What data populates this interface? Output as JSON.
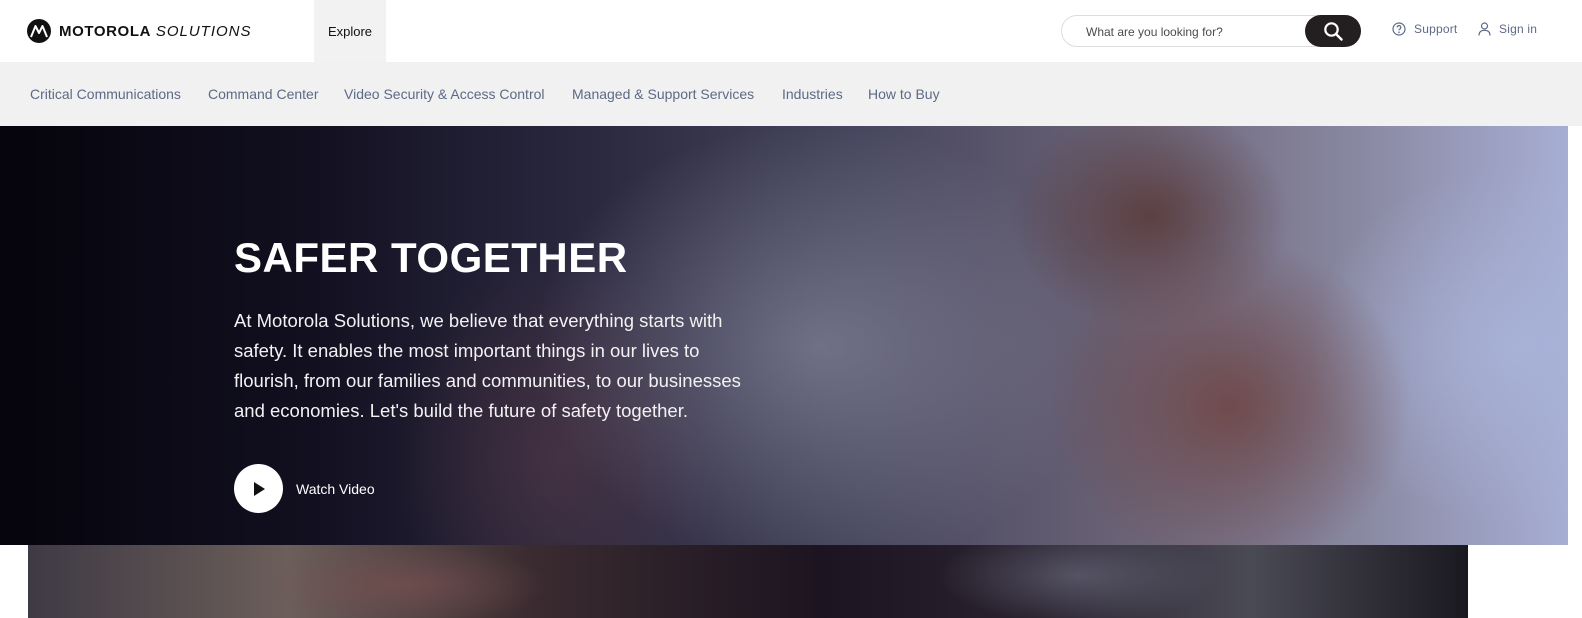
{
  "header": {
    "brand_bold": "MOTOROLA",
    "brand_light": "SOLUTIONS",
    "explore_label": "Explore",
    "search_placeholder": "What are you looking for?",
    "support_label": "Support",
    "signin_label": "Sign in"
  },
  "nav": {
    "items": [
      {
        "label": "Critical Communications"
      },
      {
        "label": "Command Center"
      },
      {
        "label": "Video Security & Access Control"
      },
      {
        "label": "Managed & Support Services"
      },
      {
        "label": "Industries"
      },
      {
        "label": "How to Buy"
      }
    ]
  },
  "hero": {
    "title": "SAFER TOGETHER",
    "body": "At Motorola Solutions, we believe that everything starts with safety. It enables the most important things in our lives to flourish, from our families and communities, to our businesses and economies. Let's build the future of safety together.",
    "watch_label": "Watch Video"
  },
  "icons": {
    "logo": "motorola-batwing-logo-icon",
    "search": "search-icon",
    "support": "help-circle-icon",
    "signin": "user-icon",
    "play": "play-icon"
  },
  "colors": {
    "nav_text": "#5d6a85",
    "search_button": "#231f20",
    "nav_background": "#f1f1f1"
  }
}
